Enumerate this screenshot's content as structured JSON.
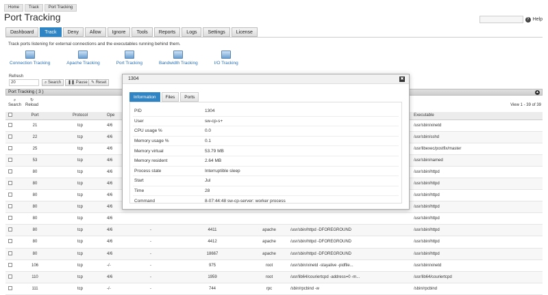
{
  "breadcrumb": [
    "Home",
    "Track",
    "Port Tracking"
  ],
  "page_title": "Port Tracking",
  "help_label": "Help",
  "tabs": [
    "Dashboard",
    "Track",
    "Deny",
    "Allow",
    "Ignore",
    "Tools",
    "Reports",
    "Logs",
    "Settings",
    "License"
  ],
  "active_tab": "Track",
  "intro": "Track ports listening for external connections and the executables running behind them.",
  "tools": [
    "Connection Tracking",
    "Apache Tracking",
    "Port Tracking",
    "Bandwidth Tracking",
    "I/O Tracking"
  ],
  "refresh": {
    "label": "Refresh",
    "value": "20",
    "search": "Search",
    "pause": "Pause",
    "reset": "Reset"
  },
  "grid": {
    "title": "Port Tracking ( 3 )",
    "search": "Search",
    "reload": "Reload",
    "view_info": "View 1 - 39 of 39",
    "columns": [
      "Port",
      "Protocol",
      "Ope",
      "",
      "",
      "",
      "",
      "",
      "Executable"
    ],
    "rows": [
      [
        "21",
        "tcp",
        "4/6",
        "",
        "",
        "",
        "",
        "/usr/sbin/xinetd"
      ],
      [
        "22",
        "tcp",
        "4/6",
        "",
        "",
        "",
        "",
        "/usr/sbin/sshd"
      ],
      [
        "25",
        "tcp",
        "4/6",
        "",
        "",
        "",
        "",
        "/usr/libexec/postfix/master"
      ],
      [
        "53",
        "tcp",
        "4/6",
        "",
        "",
        "",
        "",
        "/usr/sbin/named"
      ],
      [
        "80",
        "tcp",
        "4/6",
        "",
        "",
        "",
        "",
        "/usr/sbin/httpd"
      ],
      [
        "80",
        "tcp",
        "4/6",
        "",
        "",
        "",
        "",
        "/usr/sbin/httpd"
      ],
      [
        "80",
        "tcp",
        "4/6",
        "",
        "",
        "",
        "",
        "/usr/sbin/httpd"
      ],
      [
        "80",
        "tcp",
        "4/6",
        "",
        "",
        "",
        "",
        "/usr/sbin/httpd"
      ],
      [
        "80",
        "tcp",
        "4/6",
        "",
        "",
        "",
        "",
        "/usr/sbin/httpd"
      ],
      [
        "80",
        "tcp",
        "4/6",
        "-",
        "4411",
        "apache",
        "/usr/sbin/httpd -DFOREGROUND",
        "/usr/sbin/httpd"
      ],
      [
        "80",
        "tcp",
        "4/6",
        "-",
        "4412",
        "apache",
        "/usr/sbin/httpd -DFOREGROUND",
        "/usr/sbin/httpd"
      ],
      [
        "80",
        "tcp",
        "4/6",
        "-",
        "18667",
        "apache",
        "/usr/sbin/httpd -DFOREGROUND",
        "/usr/sbin/httpd"
      ],
      [
        "106",
        "tcp",
        "-/-",
        "-",
        "975",
        "root",
        "/usr/sbin/xinetd -stayalive -pidfile...",
        "/usr/sbin/xinetd"
      ],
      [
        "110",
        "tcp",
        "4/6",
        "-",
        "1959",
        "root",
        "/usr/lib64/couriertcpd -address=0 -m...",
        "/usr/lib64/couriertcpd"
      ],
      [
        "111",
        "tcp",
        "-/-",
        "-",
        "744",
        "rpc",
        "/sbin/rpcbind -w",
        "/sbin/rpcbind"
      ]
    ]
  },
  "dialog": {
    "title": "1304",
    "tabs": [
      "Information",
      "Files",
      "Ports"
    ],
    "active_tab": "Information",
    "fields": [
      {
        "label": "PID",
        "value": "1304"
      },
      {
        "label": "User",
        "value": "sw-cp-s+"
      },
      {
        "label": "CPU usage %",
        "value": "0.0"
      },
      {
        "label": "Memory usage %",
        "value": "0.1"
      },
      {
        "label": "Memory virtual",
        "value": "53.79 MB"
      },
      {
        "label": "Memory resident",
        "value": "2.64 MB"
      },
      {
        "label": "Process state",
        "value": "Interruptible sleep"
      },
      {
        "label": "Start",
        "value": "Jul"
      },
      {
        "label": "Time",
        "value": "28"
      },
      {
        "label": "Command",
        "value": "8-07:44:48 sw-cp-server: worker process"
      }
    ]
  },
  "colors": {
    "accent": "#2f85c3",
    "link": "#2a6fb5"
  }
}
